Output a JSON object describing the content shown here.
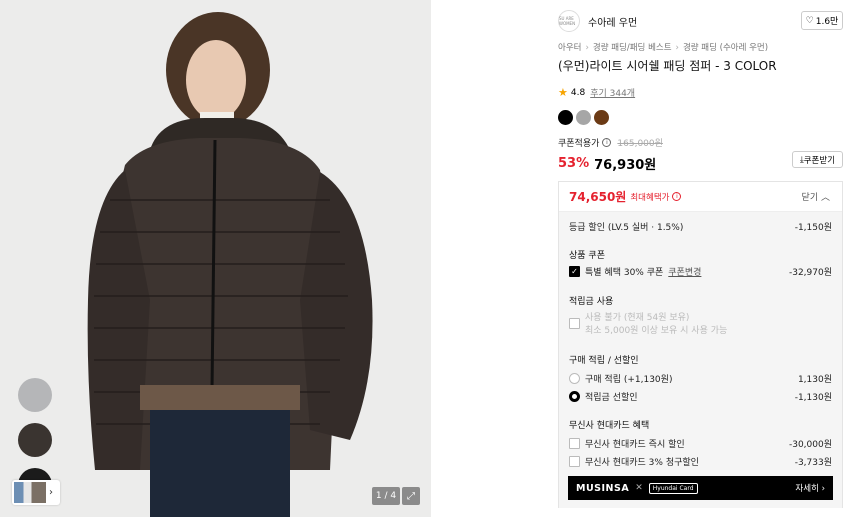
{
  "gallery": {
    "counter": "1 / 4",
    "expand_icon": "expand-icon",
    "thumb_colors": [
      "#b5b6b8",
      "#3a3430",
      "#1b1b1b"
    ]
  },
  "brand": {
    "logo_text": "SU ARE WOMEN",
    "name": "수아레 우먼",
    "likes": "1.6만"
  },
  "breadcrumb": [
    "아우터",
    "경량 패딩/패딩 베스트",
    "경량 패딩 (수아레 우먼)"
  ],
  "product": {
    "title": "(우먼)라이트 시어쉘 패딩 점퍼 - 3 COLOR",
    "rating": "4.8",
    "reviews": "후기 344개",
    "swatches": [
      "#000000",
      "#a6a6a6",
      "#6b3a15"
    ]
  },
  "price": {
    "coupon_label": "쿠폰적용가",
    "original": "165,000원",
    "discount": "53%",
    "sale": "76,930원",
    "coupon_button": "쿠폰받기"
  },
  "benefits": {
    "max_price": "74,650원",
    "max_label": "최대혜택가",
    "close_label": "닫기",
    "grade_label": "등급 할인 (LV.5 실버 · 1.5%)",
    "grade_amount": "-1,150원",
    "coupon_section": "상품 쿠폰",
    "coupon_item": "특별 혜택 30% 쿠폰",
    "coupon_change": "쿠폰변경",
    "coupon_amount": "-32,970원",
    "points_section": "적립금 사용",
    "points_line1": "사용 불가 (현재 54원 보유)",
    "points_line2": "최소 5,000원 이상 보유 시 사용 가능",
    "purchase_section": "구매 적립 / 선할인",
    "purchase_opt1": "구매 적립 (+1,130원)",
    "purchase_opt1_amt": "1,130원",
    "purchase_opt2": "적립금 선할인",
    "purchase_opt2_amt": "-1,130원",
    "card_section": "무신사 현대카드 혜택",
    "card_opt1": "무신사 현대카드 즉시 할인",
    "card_opt1_amt": "-30,000원",
    "card_opt2": "무신사 현대카드 3% 청구할인",
    "card_opt2_amt": "-3,733원",
    "banner_brand": "MUSINSA",
    "banner_card": "Hyundai Card",
    "banner_more": "자세히"
  }
}
